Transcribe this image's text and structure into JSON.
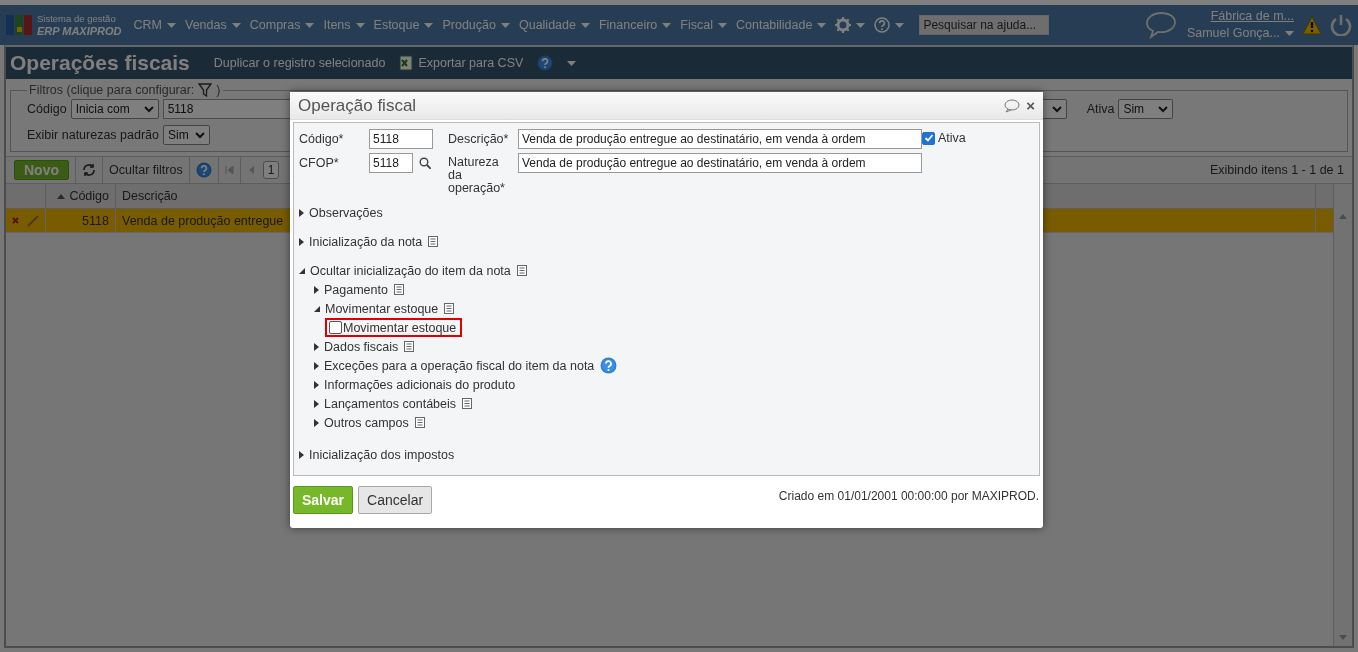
{
  "topbar": {
    "logo": {
      "line_1": "Sistema de gestão",
      "line_2": "ERP MAXIPROD"
    },
    "menu": [
      {
        "label": "CRM"
      },
      {
        "label": "Vendas"
      },
      {
        "label": "Compras"
      },
      {
        "label": "Itens"
      },
      {
        "label": "Estoque"
      },
      {
        "label": "Produção"
      },
      {
        "label": "Qualidade"
      },
      {
        "label": "Financeiro"
      },
      {
        "label": "Fiscal"
      },
      {
        "label": "Contabilidade"
      }
    ],
    "search": {
      "placeholder": "Pesquisar na ajuda..."
    },
    "company": "Fábrica de m...",
    "user": "Samuel Gonça..."
  },
  "page": {
    "title": "Operações fiscais",
    "actions": [
      "Duplicar o registro selecionado",
      "Exportar para CSV"
    ]
  },
  "filters": {
    "legend": "Filtros (clique para configurar:",
    "legend_end": ")",
    "fields": [
      {
        "label": "Código",
        "operator": "Inicia com",
        "value": "5118"
      },
      {
        "label": "Ativa",
        "value": "Sim"
      },
      {
        "label": "Exibir naturezas padrão",
        "value": "Sim"
      }
    ]
  },
  "toolbar": {
    "new_button": "Novo",
    "hide_filters": "Ocultar filtros",
    "page": "1",
    "summary": "Exibindo itens 1 - 1 de 1"
  },
  "table": {
    "columns": [
      {
        "label": "Código",
        "sorted": true
      },
      {
        "label": "Descrição",
        "sorted": false
      }
    ],
    "rows": [
      {
        "cells": [
          "5118",
          "Venda de produção entregue"
        ],
        "selected": true
      }
    ]
  },
  "dialog": {
    "title": "Operação fiscal",
    "close": "×",
    "fields": [
      {
        "label": "Código*",
        "value": "5118",
        "lookup": false
      },
      {
        "label": "Descrição*",
        "value": "Venda de produção entregue ao destinatário, em venda à ordem",
        "lookup": false
      },
      {
        "label": "CFOP*",
        "value": "5118",
        "lookup": true
      },
      {
        "label": "Natureza da operação*",
        "value": "Venda de produção entregue ao destinatário, em venda à ordem",
        "lookup": false
      }
    ],
    "active": {
      "label": "Ativa",
      "checked": true
    },
    "sections": [
      {
        "kind": "section",
        "label": "Observações",
        "expanded": false,
        "notes": false,
        "help": false
      },
      {
        "kind": "section",
        "label": "Inicialização da nota",
        "expanded": false,
        "notes": true,
        "help": false
      },
      {
        "kind": "section",
        "label": "Ocultar inicialização do item da nota",
        "expanded": true,
        "notes": true,
        "help": false,
        "children": [
          {
            "kind": "section",
            "label": "Pagamento",
            "expanded": false,
            "notes": true,
            "help": false
          },
          {
            "kind": "section",
            "label": "Movimentar estoque",
            "expanded": true,
            "notes": true,
            "help": false,
            "children": [
              {
                "kind": "checkbox",
                "label": "Movimentar estoque",
                "checked": false,
                "highlighted": true
              }
            ]
          },
          {
            "kind": "section",
            "label": "Dados fiscais",
            "expanded": false,
            "notes": true,
            "help": false
          },
          {
            "kind": "section",
            "label": "Exceções para a operação fiscal do item da nota",
            "expanded": false,
            "notes": false,
            "help": true
          },
          {
            "kind": "section",
            "label": "Informações adicionais do produto",
            "expanded": false,
            "notes": false,
            "help": false
          },
          {
            "kind": "section",
            "label": "Lançamentos contábeis",
            "expanded": false,
            "notes": true,
            "help": false
          },
          {
            "kind": "section",
            "label": "Outros campos",
            "expanded": false,
            "notes": true,
            "help": false
          }
        ]
      },
      {
        "kind": "section",
        "label": "Inicialização dos impostos",
        "expanded": false,
        "notes": false,
        "help": false
      }
    ],
    "buttons": [
      {
        "label": "Salvar",
        "kind": "primary"
      },
      {
        "label": "Cancelar",
        "kind": "secondary"
      }
    ],
    "footer_note": "Criado em 01/01/2001 00:00:00 por MAXIPROD."
  }
}
